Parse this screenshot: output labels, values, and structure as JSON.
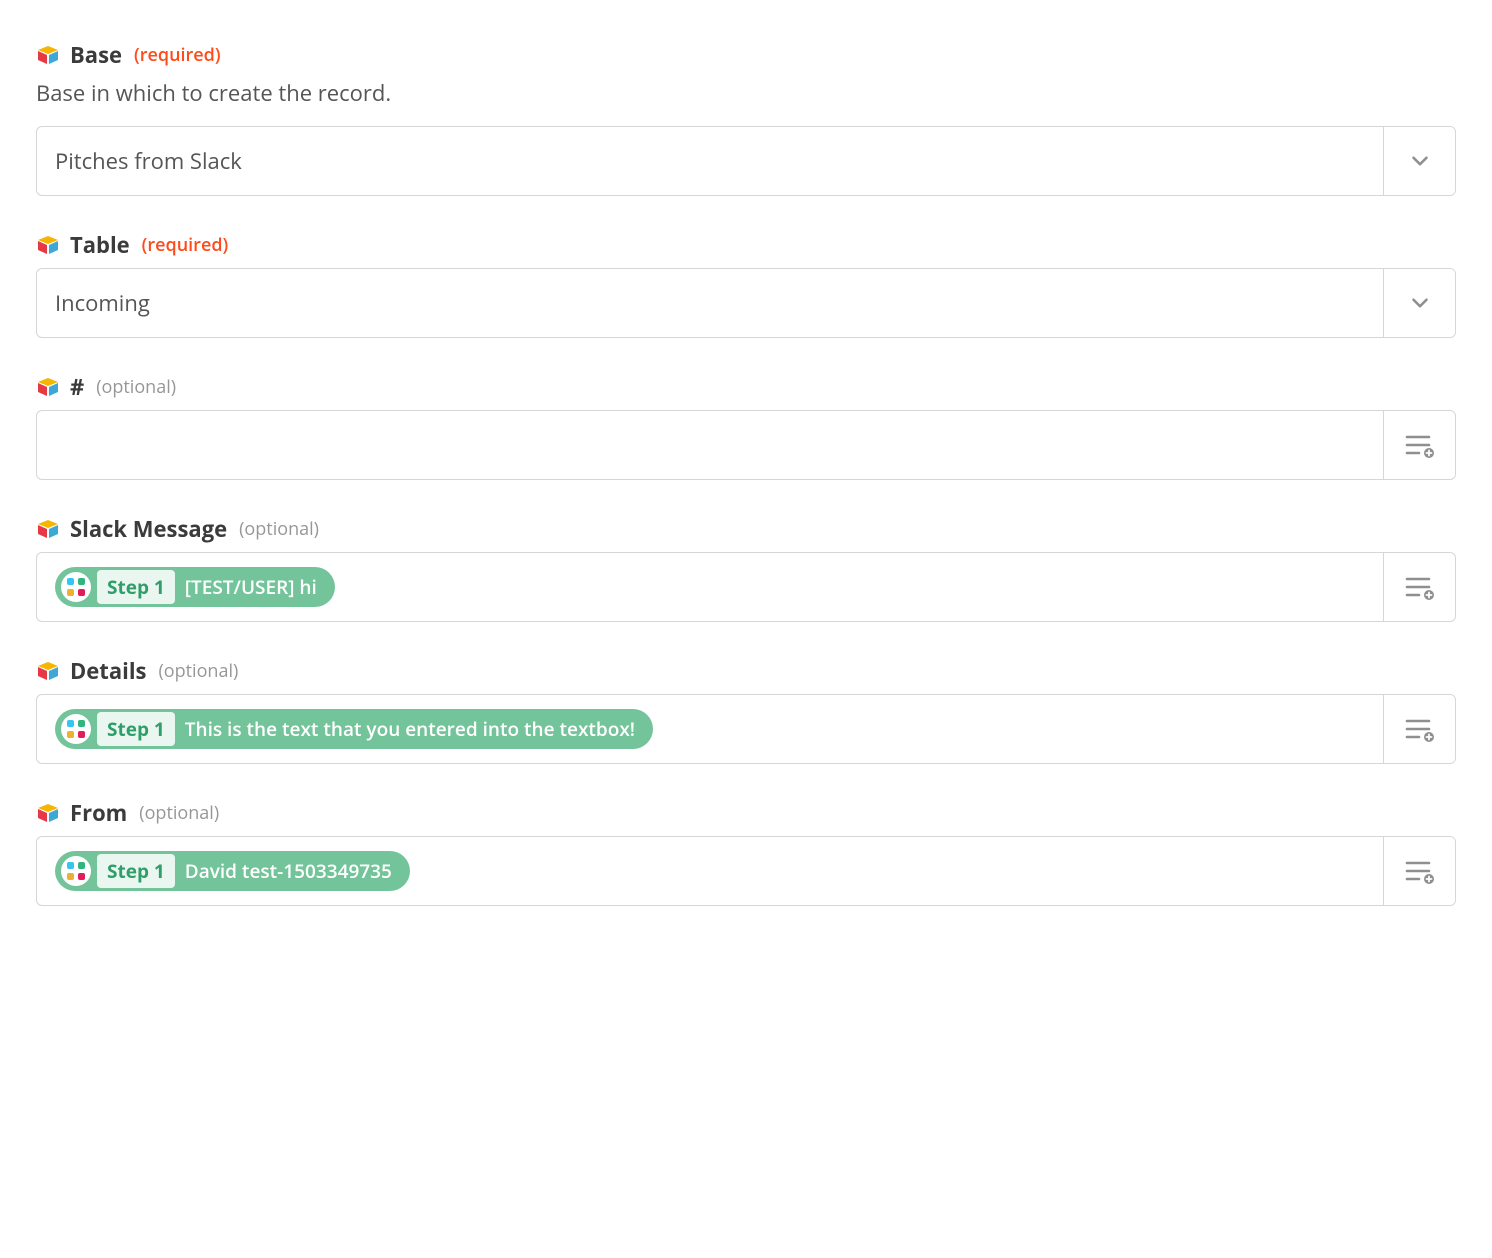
{
  "required_text": "(required)",
  "optional_text": "(optional)",
  "fields": {
    "base": {
      "label": "Base",
      "helper": "Base in which to create the record.",
      "value": "Pitches from Slack"
    },
    "table": {
      "label": "Table",
      "value": "Incoming"
    },
    "hash": {
      "label": "#"
    },
    "slack_message": {
      "label": "Slack Message",
      "pill_step": "Step 1",
      "pill_value": "[TEST/USER] hi"
    },
    "details": {
      "label": "Details",
      "pill_step": "Step 1",
      "pill_value": "This is the text that you entered into the textbox!"
    },
    "from": {
      "label": "From",
      "pill_step": "Step 1",
      "pill_value": "David test-1503349735"
    }
  }
}
